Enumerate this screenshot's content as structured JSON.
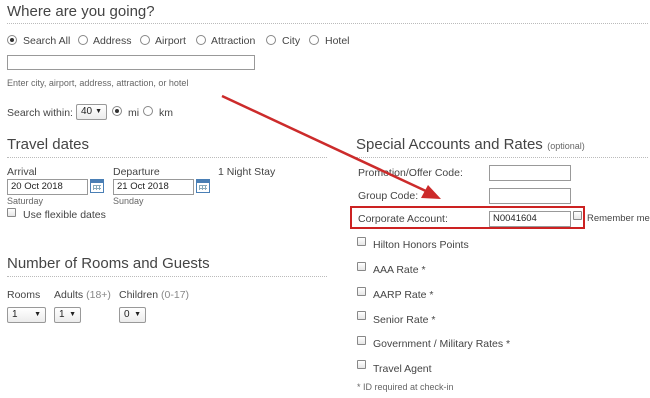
{
  "heading_where": "Where are you going?",
  "search_types": [
    {
      "label": "Search All",
      "selected": true
    },
    {
      "label": "Address",
      "selected": false
    },
    {
      "label": "Airport",
      "selected": false
    },
    {
      "label": "Attraction",
      "selected": false
    },
    {
      "label": "City",
      "selected": false
    },
    {
      "label": "Hotel",
      "selected": false
    }
  ],
  "destination_input": {
    "value": ""
  },
  "destination_hint": "Enter city, airport, address, attraction, or hotel",
  "search_within": {
    "label": "Search within:",
    "value": "40",
    "units": [
      {
        "label": "mi",
        "selected": true
      },
      {
        "label": "km",
        "selected": false
      }
    ]
  },
  "travel_dates": {
    "heading": "Travel dates",
    "arrival_label": "Arrival",
    "arrival_value": "20 Oct 2018",
    "arrival_day": "Saturday",
    "departure_label": "Departure",
    "departure_value": "21 Oct 2018",
    "departure_day": "Sunday",
    "nights": "1 Night Stay",
    "flexible_label": "Use flexible dates"
  },
  "rooms_guests": {
    "heading": "Number of Rooms and Guests",
    "rooms_label": "Rooms",
    "rooms_value": "1",
    "adults_label": "Adults",
    "adults_note": "(18+)",
    "adults_value": "1",
    "children_label": "Children",
    "children_note": "(0-17)",
    "children_value": "0"
  },
  "special": {
    "heading": "Special Accounts and Rates",
    "optional": "(optional)",
    "promo_label": "Promotion/Offer Code:",
    "promo_value": "",
    "group_label": "Group Code:",
    "group_value": "",
    "corporate_label": "Corporate Account:",
    "corporate_value": "N0041604",
    "remember_label": "Remember me",
    "rates": [
      {
        "label": "Hilton Honors Points"
      },
      {
        "label": "AAA Rate *"
      },
      {
        "label": "AARP Rate *"
      },
      {
        "label": "Senior Rate *"
      },
      {
        "label": "Government / Military Rates *"
      },
      {
        "label": "Travel Agent"
      }
    ],
    "footnote": "* ID required at check-in"
  },
  "colors": {
    "highlight": "#cc2222",
    "arrow": "#cc2b2b",
    "calendar": "#4a7fb5"
  }
}
